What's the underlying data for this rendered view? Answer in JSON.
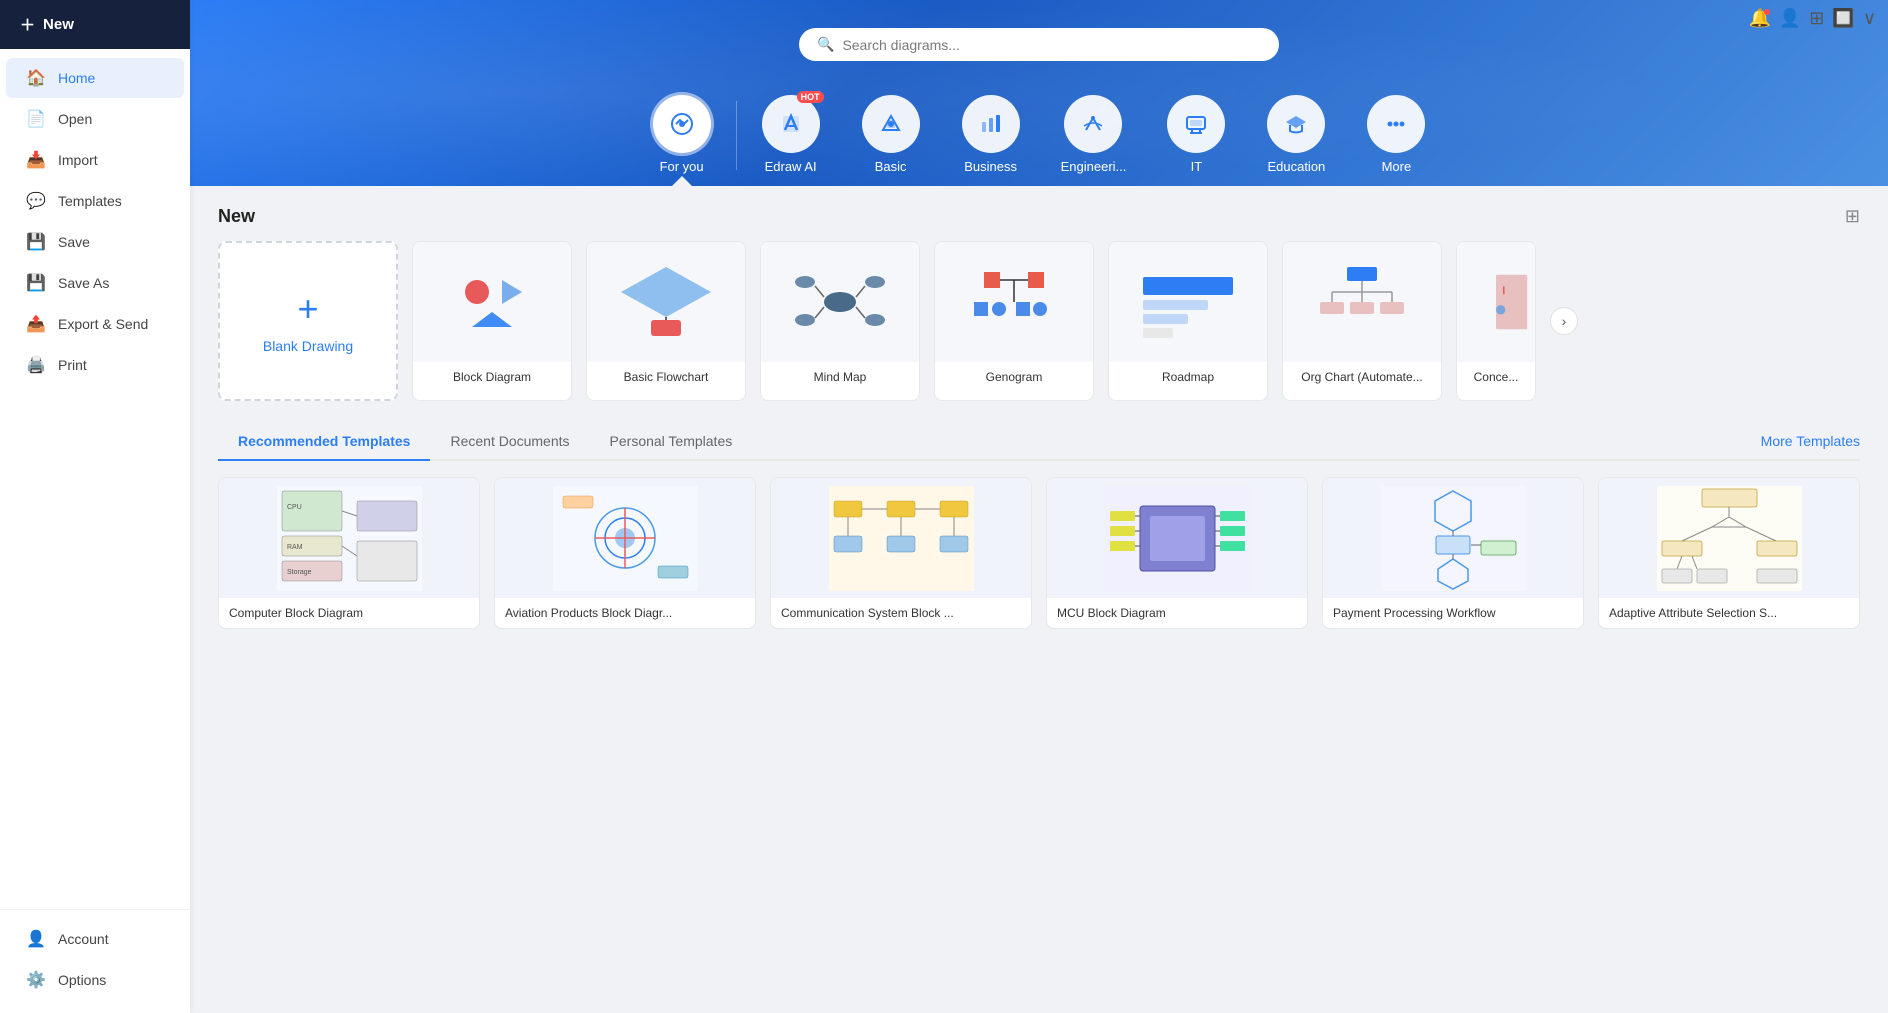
{
  "sidebar": {
    "new_label": "New",
    "items": [
      {
        "id": "home",
        "label": "Home",
        "icon": "🏠",
        "active": true
      },
      {
        "id": "open",
        "label": "Open",
        "icon": "📄"
      },
      {
        "id": "import",
        "label": "Import",
        "icon": "📥"
      },
      {
        "id": "templates",
        "label": "Templates",
        "icon": "💬"
      },
      {
        "id": "save",
        "label": "Save",
        "icon": "💾"
      },
      {
        "id": "save-as",
        "label": "Save As",
        "icon": "💾"
      },
      {
        "id": "export",
        "label": "Export & Send",
        "icon": "🖨️"
      },
      {
        "id": "print",
        "label": "Print",
        "icon": "🖨️"
      }
    ],
    "bottom_items": [
      {
        "id": "account",
        "label": "Account",
        "icon": "👤"
      },
      {
        "id": "options",
        "label": "Options",
        "icon": "⚙️"
      }
    ]
  },
  "hero": {
    "search_placeholder": "Search diagrams...",
    "categories": [
      {
        "id": "for-you",
        "label": "For you",
        "icon": "⚙️",
        "active": true
      },
      {
        "id": "edraw-ai",
        "label": "Edraw AI",
        "icon": "✏️",
        "hot": true
      },
      {
        "id": "basic",
        "label": "Basic",
        "icon": "🏷️"
      },
      {
        "id": "business",
        "label": "Business",
        "icon": "📊"
      },
      {
        "id": "engineering",
        "label": "Engineeri...",
        "icon": "⛑️"
      },
      {
        "id": "it",
        "label": "IT",
        "icon": "🖥️"
      },
      {
        "id": "education",
        "label": "Education",
        "icon": "🎓"
      },
      {
        "id": "more",
        "label": "More",
        "icon": "⋯"
      }
    ]
  },
  "new_section": {
    "title": "New",
    "blank_label": "Blank Drawing",
    "templates": [
      {
        "id": "block-diagram",
        "label": "Block Diagram"
      },
      {
        "id": "basic-flowchart",
        "label": "Basic Flowchart"
      },
      {
        "id": "mind-map",
        "label": "Mind Map"
      },
      {
        "id": "genogram",
        "label": "Genogram"
      },
      {
        "id": "roadmap",
        "label": "Roadmap"
      },
      {
        "id": "org-chart",
        "label": "Org Chart (Automate..."
      },
      {
        "id": "conce",
        "label": "Conce..."
      }
    ]
  },
  "recommended": {
    "tabs": [
      {
        "id": "recommended",
        "label": "Recommended Templates",
        "active": true
      },
      {
        "id": "recent",
        "label": "Recent Documents"
      },
      {
        "id": "personal",
        "label": "Personal Templates"
      }
    ],
    "more_label": "More Templates",
    "cards": [
      {
        "id": "computer-block",
        "label": "Computer Block Diagram"
      },
      {
        "id": "aviation-block",
        "label": "Aviation Products Block Diagr..."
      },
      {
        "id": "comm-system",
        "label": "Communication System Block ..."
      },
      {
        "id": "mcu-block",
        "label": "MCU Block Diagram"
      },
      {
        "id": "payment-workflow",
        "label": "Payment Processing Workflow"
      },
      {
        "id": "adaptive-attr",
        "label": "Adaptive Attribute Selection S..."
      }
    ]
  },
  "topbar": {
    "icons": [
      "🔔",
      "👤",
      "⊞",
      "🔲",
      "∨"
    ]
  }
}
